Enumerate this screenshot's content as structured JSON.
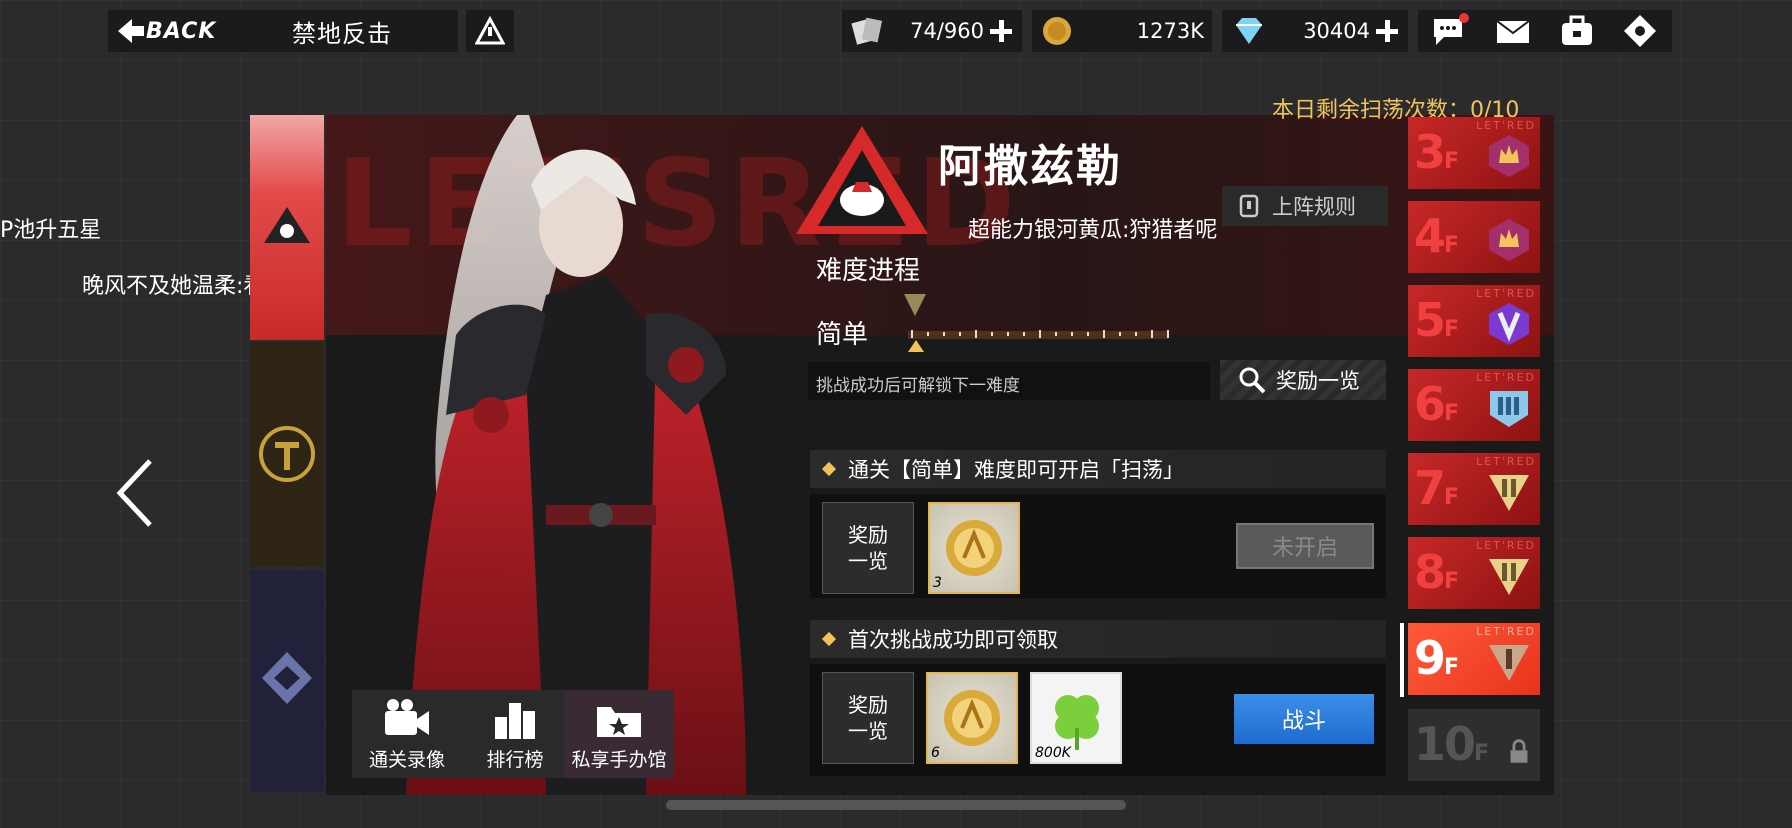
{
  "topbar": {
    "back_label": "BACK",
    "stage_title": "禁地反击",
    "stamina": "74/960",
    "coins": "1273K",
    "diamonds": "30404"
  },
  "overlay": {
    "line1": "P池升五星",
    "line2": "晚风不及她温柔:看我"
  },
  "sweep": {
    "label": "本日剩余扫荡次数：0/10"
  },
  "boss": {
    "name": "阿撒兹勒",
    "subtitle": "超能力银河黄瓜:狩猎者呢",
    "rules_label": "上阵规则"
  },
  "difficulty": {
    "title": "难度进程",
    "current": "简单",
    "hint": "挑战成功后可解锁下一难度",
    "rewards_button": "奖励一览"
  },
  "section_sweep": {
    "header": "通关【简单】难度即可开启「扫荡」",
    "list_label_1": "奖励",
    "list_label_2": "一览",
    "item_count": "3",
    "button": "未开启"
  },
  "section_first": {
    "header": "首次挑战成功即可领取",
    "list_label_1": "奖励",
    "list_label_2": "一览",
    "item1_count": "6",
    "item2_count": "800K",
    "button": "战斗"
  },
  "shortcuts": {
    "replay": "通关录像",
    "ranking": "排行榜",
    "figures": "私享手办馆"
  },
  "floors": [
    {
      "num": "3",
      "suffix": "F",
      "tag": "LET'RED"
    },
    {
      "num": "4",
      "suffix": "F",
      "tag": ""
    },
    {
      "num": "5",
      "suffix": "F",
      "tag": "LET'RED"
    },
    {
      "num": "6",
      "suffix": "F",
      "tag": "LET'RED"
    },
    {
      "num": "7",
      "suffix": "F",
      "tag": "LET'RED"
    },
    {
      "num": "8",
      "suffix": "F",
      "tag": "LET'RED"
    },
    {
      "num": "9",
      "suffix": "F",
      "tag": "LET'RED"
    },
    {
      "num": "10",
      "suffix": "F",
      "tag": ""
    }
  ],
  "colors": {
    "accent_red": "#e24a4a",
    "gold": "#f1c45a",
    "fight_blue": "#1e6bcf"
  }
}
